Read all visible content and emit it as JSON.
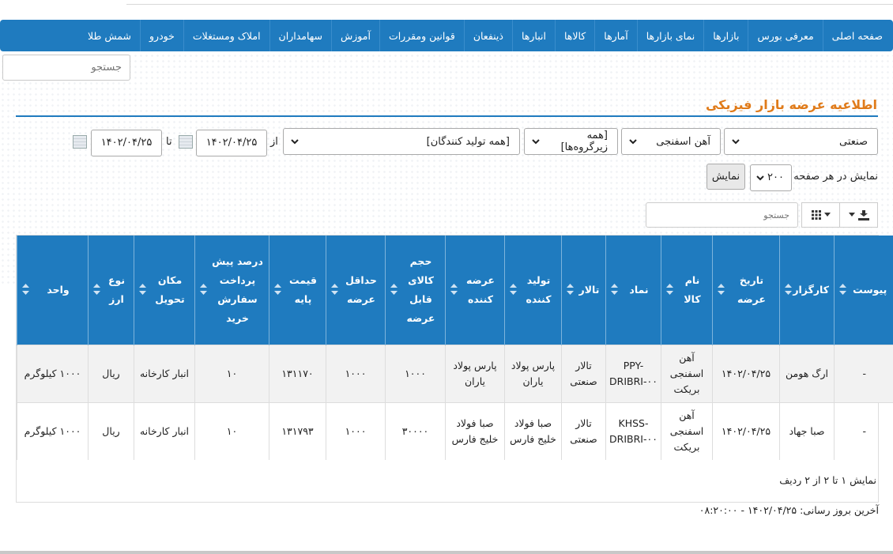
{
  "nav": {
    "items": [
      "صفحه اصلی",
      "معرفی بورس",
      "بازارها",
      "نمای بازارها",
      "آمارها",
      "کالاها",
      "انبارها",
      "ذینفعان",
      "قوانین ومقررات",
      "آموزش",
      "سهامداران",
      "املاک ومستغلات",
      "خودرو",
      "شمش طلا"
    ]
  },
  "top_search": {
    "placeholder": "جستجو"
  },
  "page_title": "اطلاعیه عرضه بازار فیزیکی",
  "filters": {
    "market": "صنعتی",
    "group": "آهن اسفنجی",
    "subgroup": "[همه زیرگروه‌ها]",
    "producer": "[همه تولید کنندگان]",
    "from_label": "از",
    "from_date": "۱۴۰۲/۰۴/۲۵",
    "to_label": "تا",
    "to_date": "۱۴۰۲/۰۴/۲۵",
    "per_page_label": "نمایش در هر صفحه",
    "per_page_value": "۲۰۰",
    "show_button": "نمایش"
  },
  "table_search": {
    "placeholder": "جستجو"
  },
  "table": {
    "headers": [
      "پیوست",
      "کارگزار",
      "تاریخ عرضه",
      "نام کالا",
      "نماد",
      "تالار",
      "تولید کننده",
      "عرضه کننده",
      "حجم کالای قابل عرضه",
      "حداقل عرضه",
      "قیمت پایه",
      "درصد پیش پرداخت سفارش خرید",
      "مکان تحویل",
      "نوع ارز",
      "واحد"
    ],
    "rows": [
      [
        "-",
        "ارگ هومن",
        "۱۴۰۲/۰۴/۲۵",
        "آهن اسفنجی بریکت",
        "PPY-DRIBRI-۰۰",
        "تالار صنعتی",
        "پارس پولاد یاران",
        "پارس پولاد یاران",
        "۱۰۰۰",
        "۱۰۰۰",
        "۱۳۱۱۷۰",
        "۱۰",
        "انبار کارخانه",
        "ریال",
        "۱۰۰۰ کیلوگرم"
      ],
      [
        "-",
        "صبا جهاد",
        "۱۴۰۲/۰۴/۲۵",
        "آهن اسفنجی بریکت",
        "KHSS-DRIBRI-۰۰",
        "تالار صنعتی",
        "صبا فولاد خلیج فارس",
        "صبا فولاد خلیج فارس",
        "۳۰۰۰۰",
        "۱۰۰۰",
        "۱۳۱۷۹۳",
        "۱۰",
        "انبار کارخانه",
        "ریال",
        "۱۰۰۰ کیلوگرم"
      ]
    ],
    "footer": "نمایش ۱ تا ۲ از ۲ ردیف"
  },
  "last_update": "آخرین بروز رسانی: ۱۴۰۲/۰۴/۲۵ - ۰۸:۲۰:۰۰",
  "colors": {
    "nav_bg": "#1f7bbf",
    "title": "#e07b1a",
    "header_bg": "#1f7bbf"
  }
}
